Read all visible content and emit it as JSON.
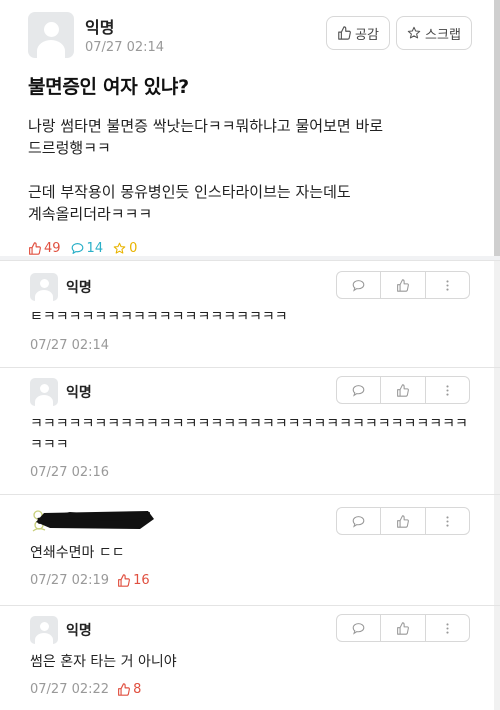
{
  "post": {
    "author": "익명",
    "time": "07/27 02:14",
    "like_button": "공감",
    "scrap_button": "스크랩",
    "title": "불면증인 여자 있냐?",
    "body_lines": [
      "나랑 썸타면 불면증 싹낫는다ㅋㅋ뭐하냐고 물어보면 바로",
      "드르렁행ㅋㅋ",
      "",
      "근데 부작용이 몽유병인듯 인스타라이브는 자는데도",
      "계속올리더라ㅋㅋㅋ"
    ],
    "stats": {
      "likes": "49",
      "comments": "14",
      "scraps": "0"
    }
  },
  "comments": [
    {
      "author": "익명",
      "text": "ㅌㅋㅋㅋㅋㅋㅋㅋㅋㅋㅋㅋㅋㅋㅋㅋㅋㅋㅋㅋ",
      "time": "07/27 02:14",
      "likes": ""
    },
    {
      "author": "익명",
      "text": "ㅋㅋㅋㅋㅋㅋㅋㅋㅋㅋㅋㅋㅋㅋㅋㅋㅋㅋㅋㅋㅋㅋㅋㅋㅋㅋㅋㅋㅋㅋㅋㅋㅋㅋㅋㅋㅋ",
      "time": "07/27 02:16",
      "likes": ""
    },
    {
      "author": "",
      "text": "연쇄수면마 ㄷㄷ",
      "time": "07/27 02:19",
      "likes": "16"
    },
    {
      "author": "익명",
      "text": "썸은 혼자 타는 거 아니야",
      "time": "07/27 02:22",
      "likes": "8"
    }
  ],
  "icons": {
    "like": "thumbs-up-icon",
    "comment": "speech-bubble-icon",
    "scrap": "star-icon",
    "more": "vertical-dots-icon"
  },
  "colors": {
    "like_red": "#e05040",
    "comment_teal": "#2bb0c8",
    "scrap_yellow": "#e9b400",
    "meta_gray": "#999999"
  }
}
